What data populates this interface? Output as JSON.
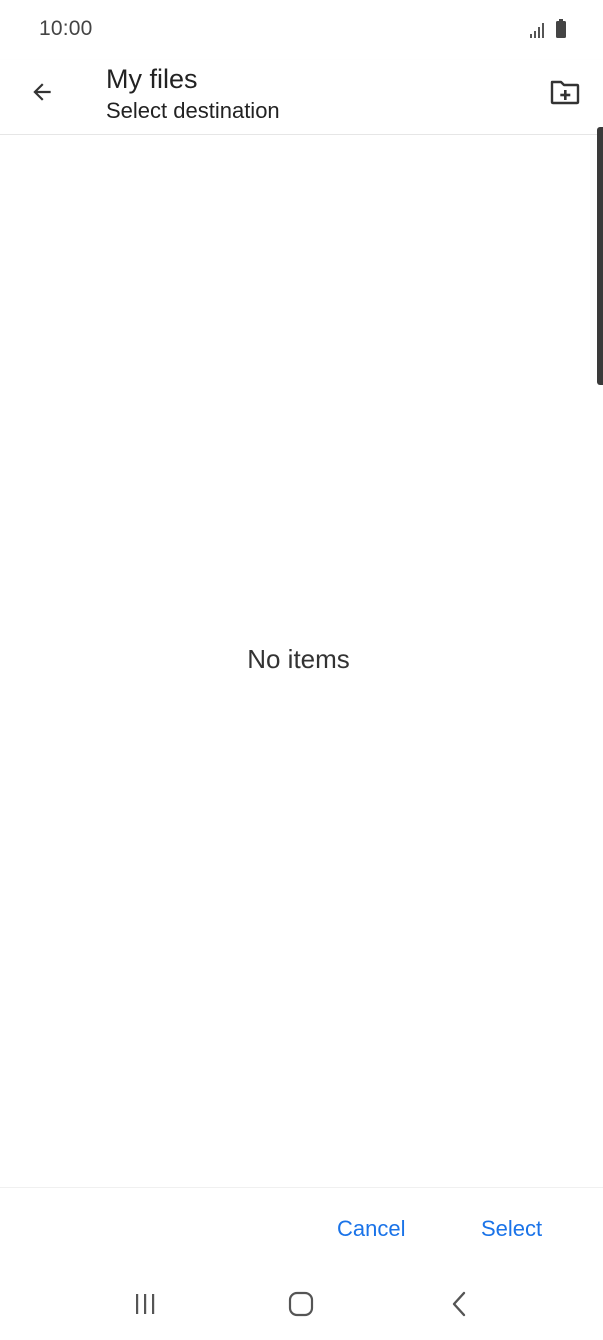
{
  "status_bar": {
    "time": "10:00",
    "icons": [
      "signal-icon",
      "battery-icon"
    ]
  },
  "app_bar": {
    "title": "My files",
    "subtitle": "Select destination",
    "back_icon": "arrow-back-icon",
    "new_folder_icon": "create-new-folder-icon"
  },
  "content": {
    "empty_message": "No items"
  },
  "actions": {
    "cancel_label": "Cancel",
    "select_label": "Select"
  },
  "nav_bar": {
    "icons": [
      "recents-icon",
      "home-icon",
      "back-icon"
    ]
  },
  "colors": {
    "accent": "#1a73e8",
    "text_primary": "#222222",
    "background": "#ffffff"
  }
}
